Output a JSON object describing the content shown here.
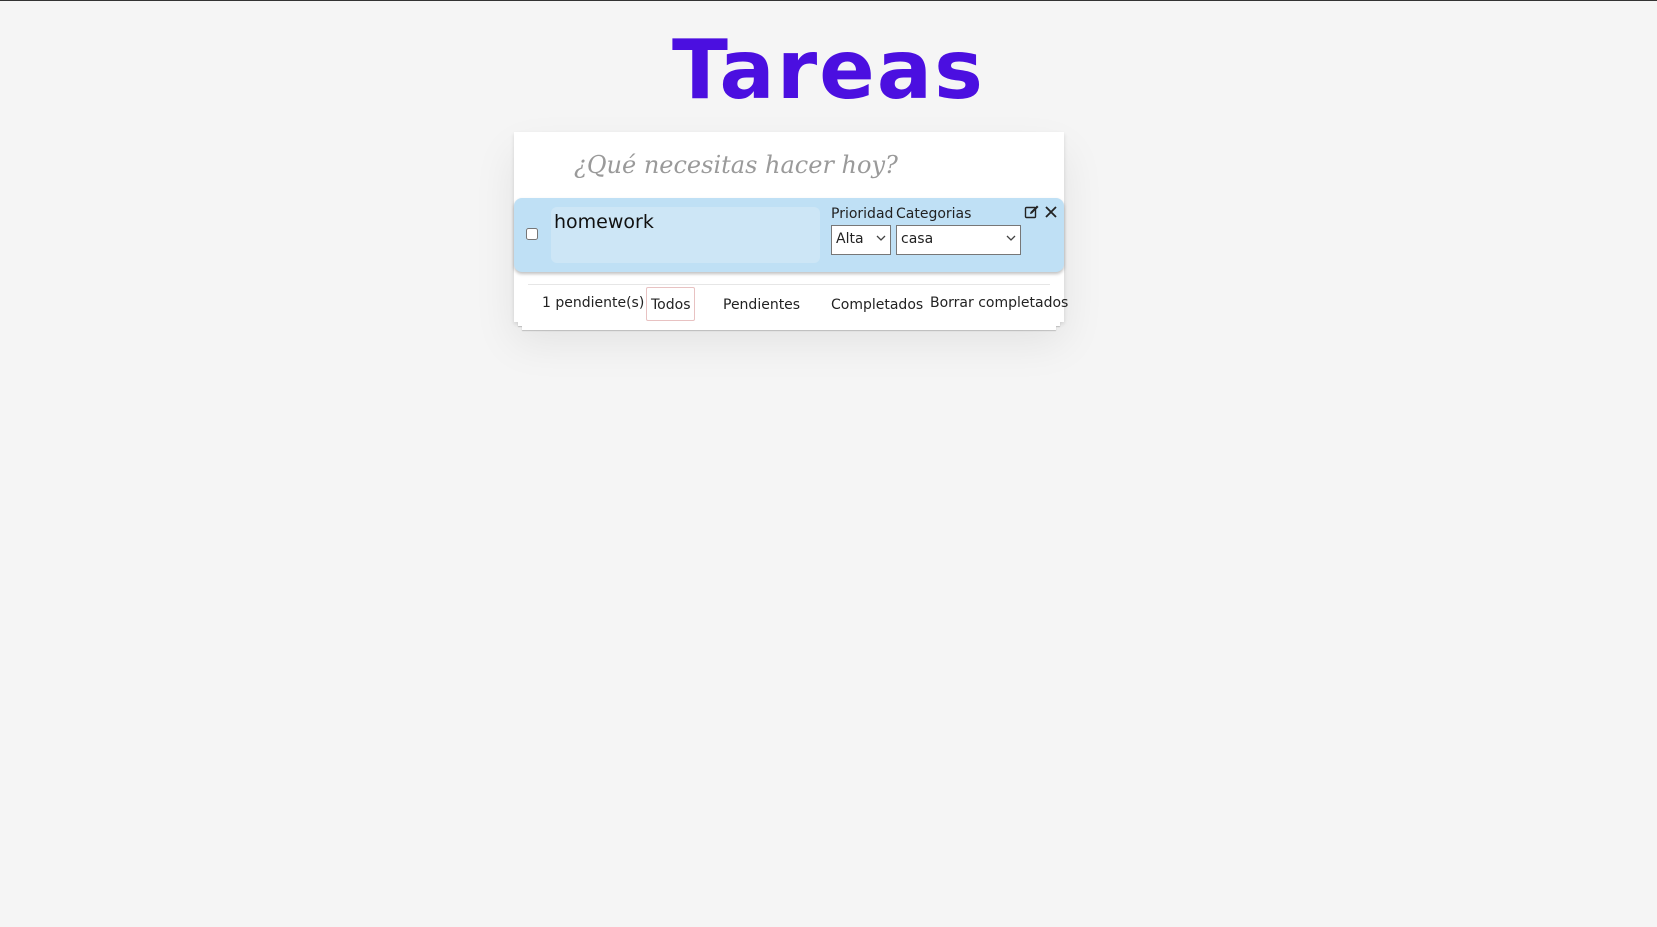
{
  "header": {
    "title": "Tareas"
  },
  "new_todo": {
    "placeholder": "¿Qué necesitas hacer hoy?",
    "value": ""
  },
  "todos": [
    {
      "text": "homework",
      "completed": false,
      "priority_label": "Prioridad",
      "priority_value": "Alta",
      "category_label": "Categorias",
      "category_value": "casa"
    }
  ],
  "footer": {
    "count_text": "1 pendiente(s)",
    "filters": [
      {
        "label": "Todos",
        "selected": true
      },
      {
        "label": "Pendientes",
        "selected": false
      },
      {
        "label": "Completados",
        "selected": false
      }
    ],
    "clear_label": "Borrar completados"
  },
  "icons": {
    "edit": "edit-icon",
    "close": "close-icon",
    "dropdown": "chevron-down-icon"
  },
  "colors": {
    "title": "#4b0fe0",
    "todo_background": "#bfe0f5",
    "background": "#f5f5f5"
  }
}
